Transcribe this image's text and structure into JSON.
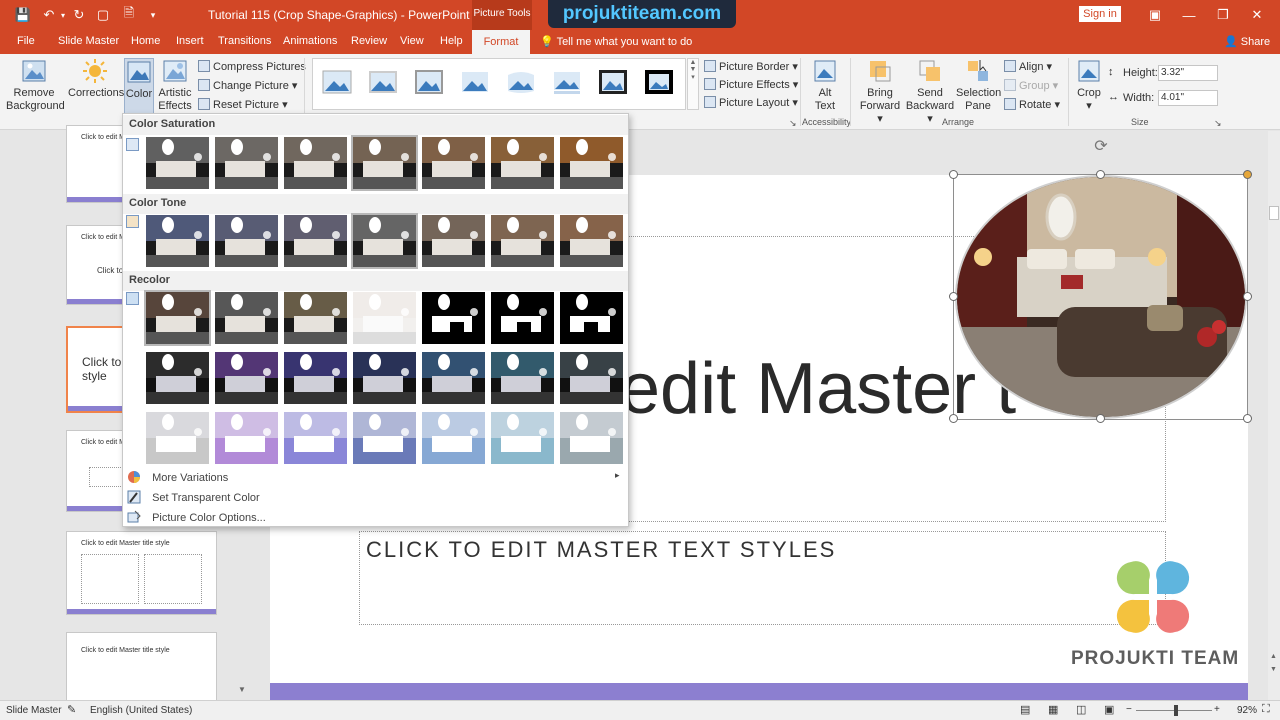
{
  "window": {
    "title": "Tutorial 115 (Crop Shape-Graphics)  -  PowerPoint",
    "contextual_group": "Picture Tools",
    "watermark": "projuktiteam.com",
    "sign_in": "Sign in"
  },
  "tabs": [
    "File",
    "Slide Master",
    "Home",
    "Insert",
    "Transitions",
    "Animations",
    "Review",
    "View",
    "Help",
    "Format"
  ],
  "tell_me": "Tell me what you want to do",
  "share": "Share",
  "ribbon": {
    "remove_background": "Remove Background",
    "corrections": "Corrections",
    "color": "Color",
    "artistic_effects": "Artistic Effects",
    "compress_pictures": "Compress Pictures",
    "change_picture": "Change Picture",
    "reset_picture": "Reset Picture",
    "picture_border": "Picture Border",
    "picture_effects": "Picture Effects",
    "picture_layout": "Picture Layout",
    "alt_text": "Alt Text",
    "accessibility_label": "Accessibility",
    "bring_forward": "Bring Forward",
    "send_backward": "Send Backward",
    "selection_pane": "Selection Pane",
    "align": "Align",
    "group": "Group",
    "rotate": "Rotate",
    "arrange_label": "Arrange",
    "crop": "Crop",
    "height_label": "Height:",
    "height_value": "3.32\"",
    "width_label": "Width:",
    "width_value": "4.01\"",
    "size_label": "Size"
  },
  "color_menu": {
    "saturation_heading": "Color Saturation",
    "tone_heading": "Color Tone",
    "recolor_heading": "Recolor",
    "more_variations": "More Variations",
    "set_transparent": "Set Transparent Color",
    "picture_color_options": "Picture Color Options..."
  },
  "thumbnails": {
    "t1": "Click to edit Master title style",
    "t2": "Click to edit Master title style",
    "t2_body": "Click to e",
    "t3": "Click to e",
    "t3_line2": "style",
    "t4": "Click to edit Master title style",
    "t5": "Click to edit Master title style",
    "t6": "Click to edit Master title style"
  },
  "slide": {
    "title_visible": "edit Master t",
    "text_placeholder": "CLICK TO EDIT MASTER TEXT STYLES",
    "logo_text": "PROJUKTI TEAM"
  },
  "status": {
    "view": "Slide Master",
    "language": "English (United States)",
    "zoom": "92%"
  },
  "colors": {
    "accent": "#d24726",
    "slide_bar": "#8c7fd0",
    "selection_orange": "#f0834a"
  }
}
